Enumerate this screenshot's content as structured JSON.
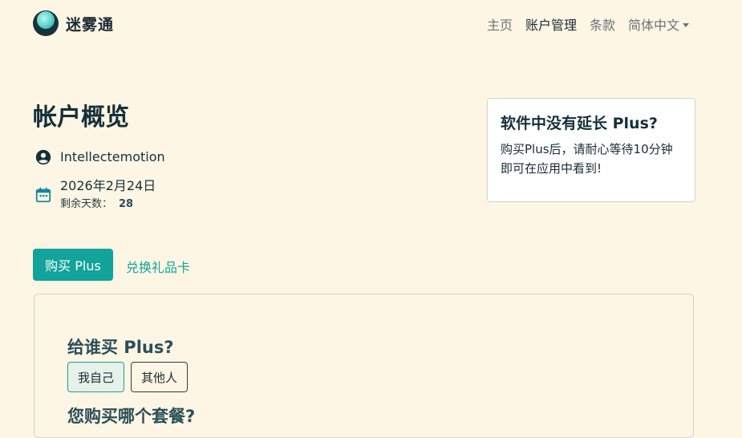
{
  "brand": {
    "name": "迷雾通"
  },
  "nav": {
    "items": [
      {
        "label": "主页",
        "active": false
      },
      {
        "label": "账户管理",
        "active": true
      },
      {
        "label": "条款",
        "active": false
      }
    ],
    "language": "简体中文"
  },
  "account": {
    "title": "帐户概览",
    "username": "Intellectemotion",
    "expiry_date": "2026年2月24日",
    "days_left_label": "剩余天数：",
    "days_left": "28"
  },
  "side_card": {
    "title": "软件中没有延长 Plus?",
    "text": "购买Plus后，请耐心等待10分钟即可在应用中看到!"
  },
  "actions": {
    "buy_label": "购买 Plus",
    "redeem_label": "兑换礼品卡"
  },
  "purchase_form": {
    "question_who": "给谁买 Plus?",
    "choices": [
      {
        "label": "我自己",
        "selected": true
      },
      {
        "label": "其他人",
        "selected": false
      }
    ],
    "question_plan": "您购买哪个套餐?"
  },
  "colors": {
    "accent": "#12a39a",
    "background": "#fef6e4",
    "heading": "#15303a"
  }
}
